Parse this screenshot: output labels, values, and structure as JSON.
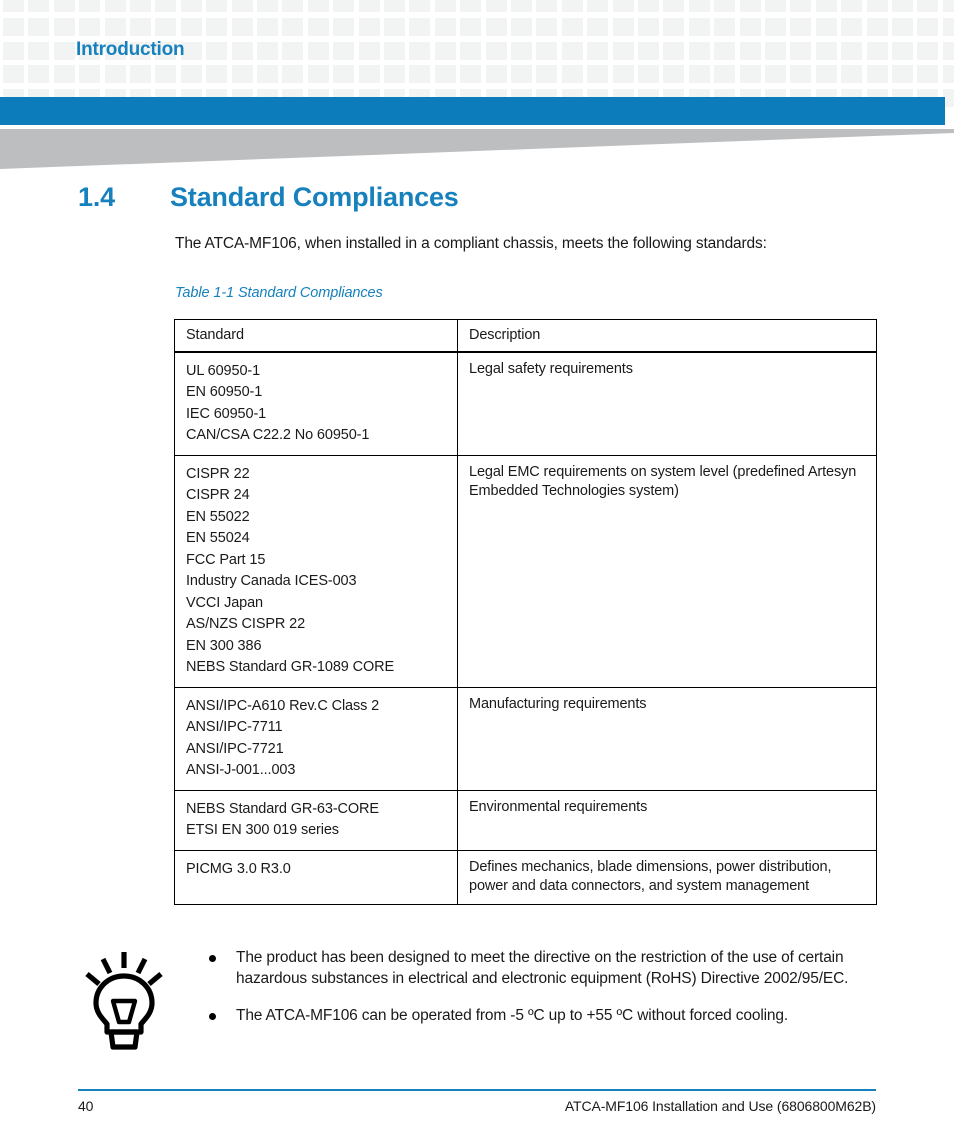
{
  "header": {
    "chapter_title": "Introduction",
    "accent_color": "#1781bd",
    "bar_color": "#0c7cba",
    "wedge_color": "#bcbec0",
    "pattern_square_color": "#f2f3f3"
  },
  "section": {
    "number": "1.4",
    "title": "Standard Compliances",
    "intro": "The ATCA-MF106, when installed in a compliant chassis, meets the following standards:"
  },
  "table": {
    "caption": "Table 1-1 Standard Compliances",
    "columns": [
      "Standard",
      "Description"
    ],
    "rows": [
      {
        "standards": [
          "UL 60950-1",
          "EN 60950-1",
          "IEC 60950-1",
          "CAN/CSA C22.2 No 60950-1"
        ],
        "description": "Legal safety requirements"
      },
      {
        "standards": [
          "CISPR 22",
          "CISPR 24",
          "EN 55022",
          "EN 55024",
          "FCC Part 15",
          "Industry Canada ICES-003",
          "VCCI Japan",
          "AS/NZS CISPR 22",
          "EN 300 386",
          "NEBS Standard GR-1089 CORE"
        ],
        "description": "Legal EMC requirements on system level (predefined Artesyn Embedded Technologies system)"
      },
      {
        "standards": [
          "ANSI/IPC-A610 Rev.C Class 2",
          "ANSI/IPC-7711",
          "ANSI/IPC-7721",
          "ANSI-J-001...003"
        ],
        "description": "Manufacturing requirements"
      },
      {
        "standards": [
          "NEBS Standard GR-63-CORE",
          "ETSI EN 300 019 series"
        ],
        "description": "Environmental requirements"
      },
      {
        "standards": [
          "PICMG 3.0 R3.0"
        ],
        "description": "Defines mechanics, blade dimensions, power distribution, power and data connectors, and system management"
      }
    ]
  },
  "note": {
    "icon": "lightbulb-tip-icon",
    "items": [
      "The product has been designed to meet the directive on the restriction of the use of certain hazardous substances in electrical and electronic equipment (RoHS) Directive 2002/95/EC.",
      "The ATCA-MF106 can be operated from -5 ºC up to +55 ºC without forced cooling."
    ]
  },
  "footer": {
    "page_number": "40",
    "document_title": "ATCA-MF106 Installation and Use (6806800M62B)",
    "rule_color": "#1781bd"
  }
}
